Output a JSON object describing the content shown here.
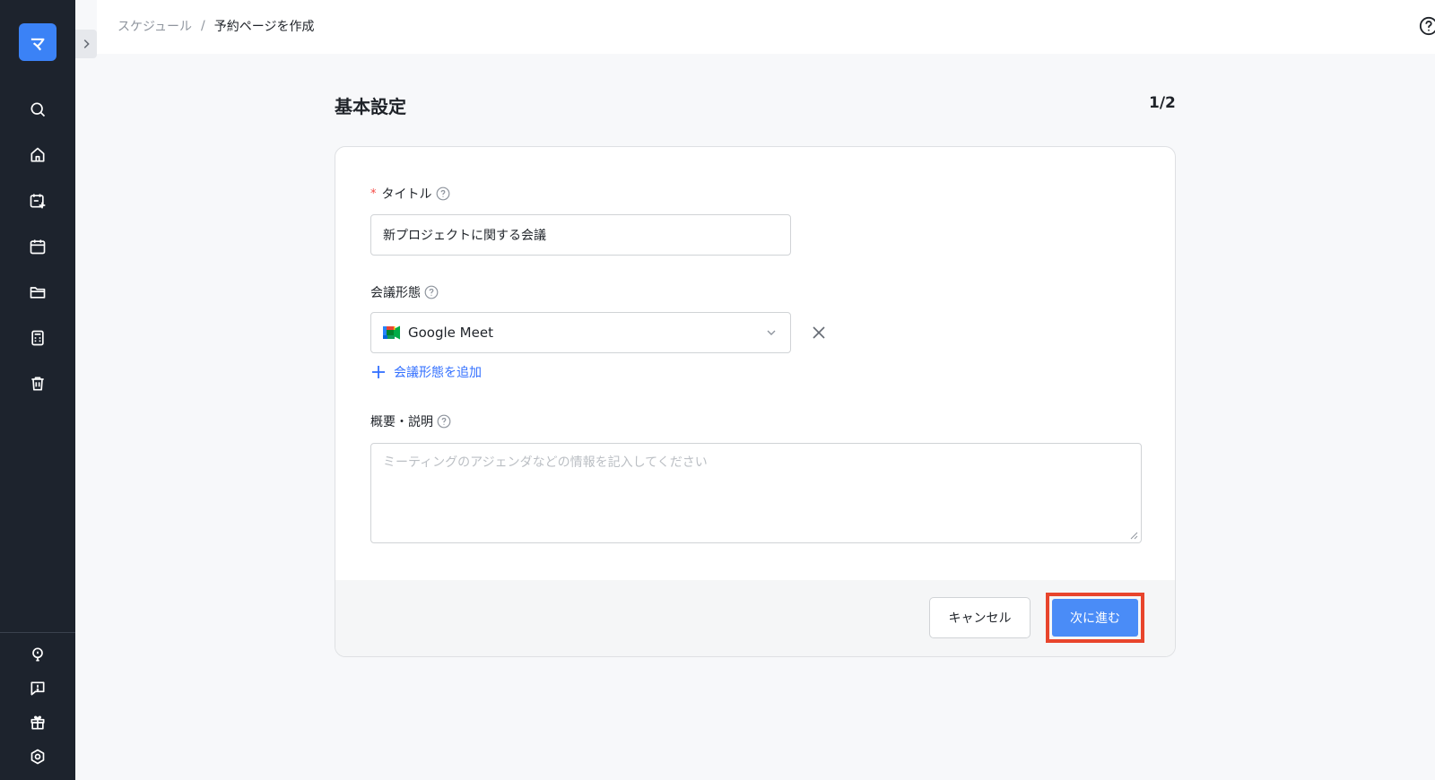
{
  "sidebar": {
    "logo_text": "マ",
    "nav_items": [
      "search-icon",
      "home-icon",
      "calendar-plus-icon",
      "calendar-icon",
      "folder-icon",
      "calculator-icon",
      "trash-icon"
    ],
    "bottom_items": [
      "lightbulb-icon",
      "chat-icon",
      "gift-icon",
      "settings-icon"
    ]
  },
  "breadcrumb": {
    "parent": "スケジュール",
    "separator": "/",
    "current": "予約ページを作成"
  },
  "page": {
    "title": "基本設定",
    "step": "1/2"
  },
  "form": {
    "title_field": {
      "required_mark": "*",
      "label": "タイトル",
      "value": "新プロジェクトに関する会議"
    },
    "meeting_type": {
      "label": "会議形態",
      "selected": "Google Meet",
      "add_label": "会議形態を追加"
    },
    "description": {
      "label": "概要・説明",
      "placeholder": "ミーティングのアジェンダなどの情報を記入してください"
    }
  },
  "footer": {
    "cancel_label": "キャンセル",
    "next_label": "次に進む"
  },
  "colors": {
    "sidebar_bg": "#1d232d",
    "accent": "#3b82f6",
    "link": "#3370ff",
    "highlight_outline": "#e8452c",
    "required": "#f54a45"
  }
}
